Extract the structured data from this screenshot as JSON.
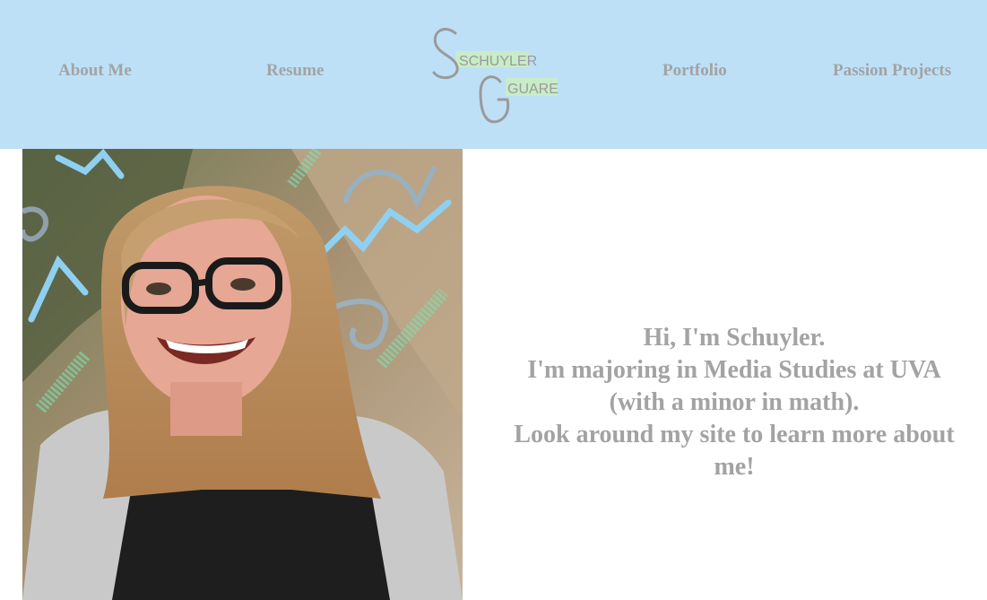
{
  "nav": {
    "about": "About Me",
    "resume": "Resume",
    "portfolio": "Portfolio",
    "passion": "Passion Projects"
  },
  "logo": {
    "line1": "SCHUYLER",
    "line2": "GUARE",
    "colors": {
      "letters": "#9a9a9a",
      "highlight": "#c8ecc8"
    }
  },
  "intro": {
    "line1": "Hi, I'm Schuyler.",
    "line2": "I'm majoring in Media Studies at UVA",
    "line3": "(with a minor in math).",
    "line4": "Look around my site to learn more about me!"
  },
  "colors": {
    "header_bg": "#bde0f7",
    "text_gray": "#a3a3a3",
    "page_bg": "#ffffff"
  }
}
